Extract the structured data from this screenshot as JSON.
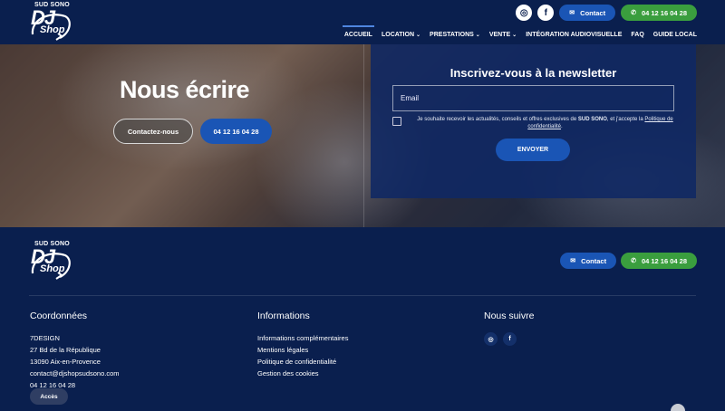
{
  "brand": {
    "tagline": "SUD SONO",
    "dj": "DJ",
    "shop": "Shop"
  },
  "header": {
    "instagram_glyph": "◎",
    "facebook_glyph": "f",
    "contact_label": "Contact",
    "phone_label": "04 12 16 04 28",
    "nav": [
      {
        "label": "ACCUEIL",
        "chevron": ""
      },
      {
        "label": "LOCATION",
        "chevron": "⌄"
      },
      {
        "label": "PRESTATIONS",
        "chevron": "⌄"
      },
      {
        "label": "VENTE",
        "chevron": "⌄"
      },
      {
        "label": "INTÉGRATION AUDIOVISUELLE",
        "chevron": ""
      },
      {
        "label": "FAQ",
        "chevron": ""
      },
      {
        "label": "GUIDE LOCAL",
        "chevron": ""
      }
    ]
  },
  "hero": {
    "title": "Nous écrire",
    "contact_button": "Contactez-nous",
    "phone_button": "04 12 16 04 28"
  },
  "newsletter": {
    "title": "Inscrivez-vous à la newsletter",
    "email_placeholder": "Email",
    "consent_prefix": "Je souhaite recevoir les actualités, conseils et offres exclusives de ",
    "consent_brand": "SUD SONO",
    "consent_middle": ", et j'accepte la ",
    "consent_link": "Politique de confidentialité",
    "consent_suffix": ".",
    "submit_label": "ENVOYER"
  },
  "footer": {
    "contact_label": "Contact",
    "phone_label": "04 12 16 04 28",
    "coords": {
      "title": "Coordonnées",
      "company": "7DESIGN",
      "street": "27 Bd de la République",
      "city": "13090 Aix-en-Provence",
      "email": "contact@djshopsudsono.com",
      "phone": "04 12 16 04 28"
    },
    "info": {
      "title": "Informations",
      "links": [
        "Informations complémentaires",
        "Mentions légales",
        "Politique de confidentialité",
        "Gestion des cookies"
      ]
    },
    "follow": {
      "title": "Nous suivre"
    },
    "acces_label": "Accès"
  },
  "colors": {
    "navy": "#0a1f4e",
    "blue": "#1a55b5",
    "green": "#3a9e3e"
  }
}
